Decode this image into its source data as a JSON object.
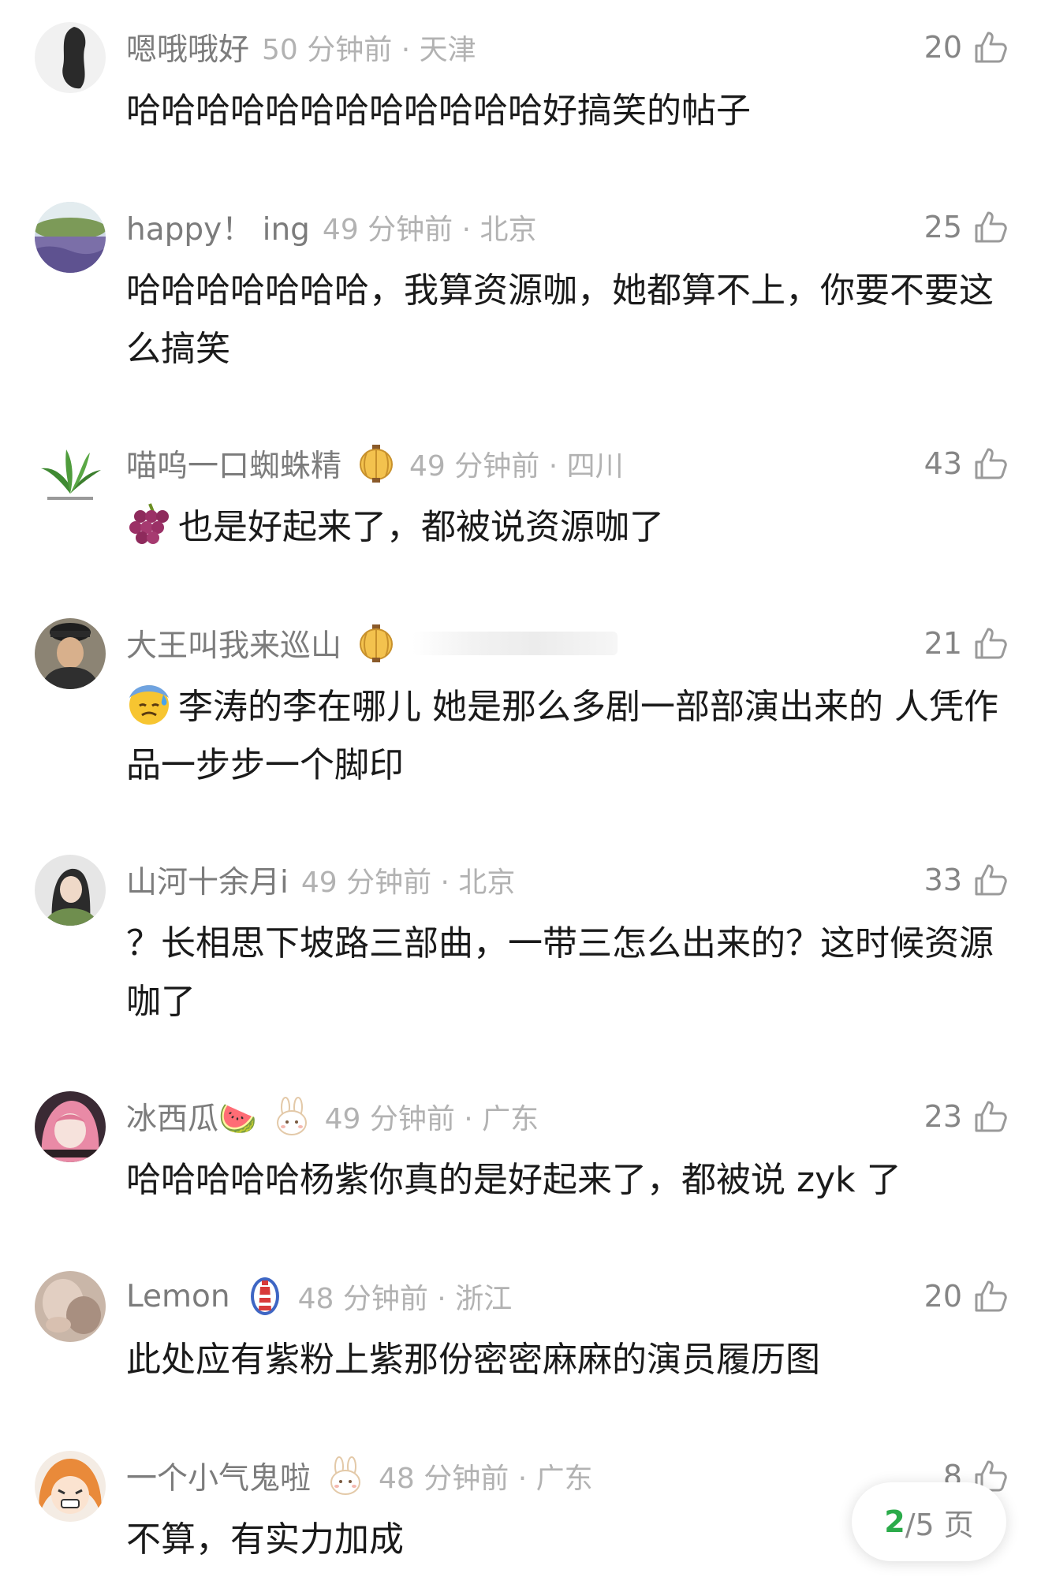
{
  "colors": {
    "accent": "#2bab4a",
    "username": "#7c7c7c",
    "meta": "#b2b2b2",
    "text": "#1a1a1a"
  },
  "comments": [
    {
      "username": "嗯哦哦好",
      "meta": "50 分钟前 · 天津",
      "likes": "20",
      "text": "哈哈哈哈哈哈哈哈哈哈哈哈好搞笑的帖子",
      "avatar": "avatar-silhouette"
    },
    {
      "username": "happy！ ing",
      "meta": "49 分钟前 · 北京",
      "likes": "25",
      "text": "哈哈哈哈哈哈哈，我算资源咖，她都算不上，你要不要这么搞笑",
      "avatar": "avatar-lavender-field"
    },
    {
      "username": "喵呜一口蜘蛛精",
      "meta": "49 分钟前 · 四川",
      "likes": "43",
      "badge": "lantern-badge",
      "emoji": "grapes-emoji",
      "text": "也是好起来了，都被说资源咖了",
      "avatar": "avatar-leaves"
    },
    {
      "username": "大王叫我来巡山",
      "meta": "",
      "likes": "21",
      "badge": "lantern-badge",
      "emoji": "sweat-face-emoji",
      "text": "李涛的李在哪儿 她是那么多剧一部部演出来的 人凭作品一步步一个脚印",
      "avatar": "avatar-person-cap"
    },
    {
      "username": "山河十余月i",
      "meta": "49 分钟前 · 北京",
      "likes": "33",
      "text": "？长相思下坡路三部曲，一带三怎么出来的？这时候资源咖了",
      "avatar": "avatar-girl"
    },
    {
      "username": "冰西瓜🍉",
      "meta": "49 分钟前 · 广东",
      "likes": "23",
      "badge": "rabbit-badge",
      "text": "哈哈哈哈哈杨紫你真的是好起来了，都被说 zyk 了",
      "avatar": "avatar-anime-pink"
    },
    {
      "username": "Lemon",
      "meta": "48 分钟前 · 浙江",
      "likes": "20",
      "badge": "lighthouse-badge",
      "text": "此处应有紫粉上紫那份密密麻麻的演员履历图",
      "avatar": "avatar-blurry"
    },
    {
      "username": "一个小气鬼啦",
      "meta": "48 分钟前 · 广东",
      "likes": "8",
      "badge": "rabbit-badge",
      "text": "不算，有实力加成",
      "avatar": "avatar-anime-orange"
    }
  ],
  "pager": {
    "current": "2",
    "total": "/5 页"
  }
}
